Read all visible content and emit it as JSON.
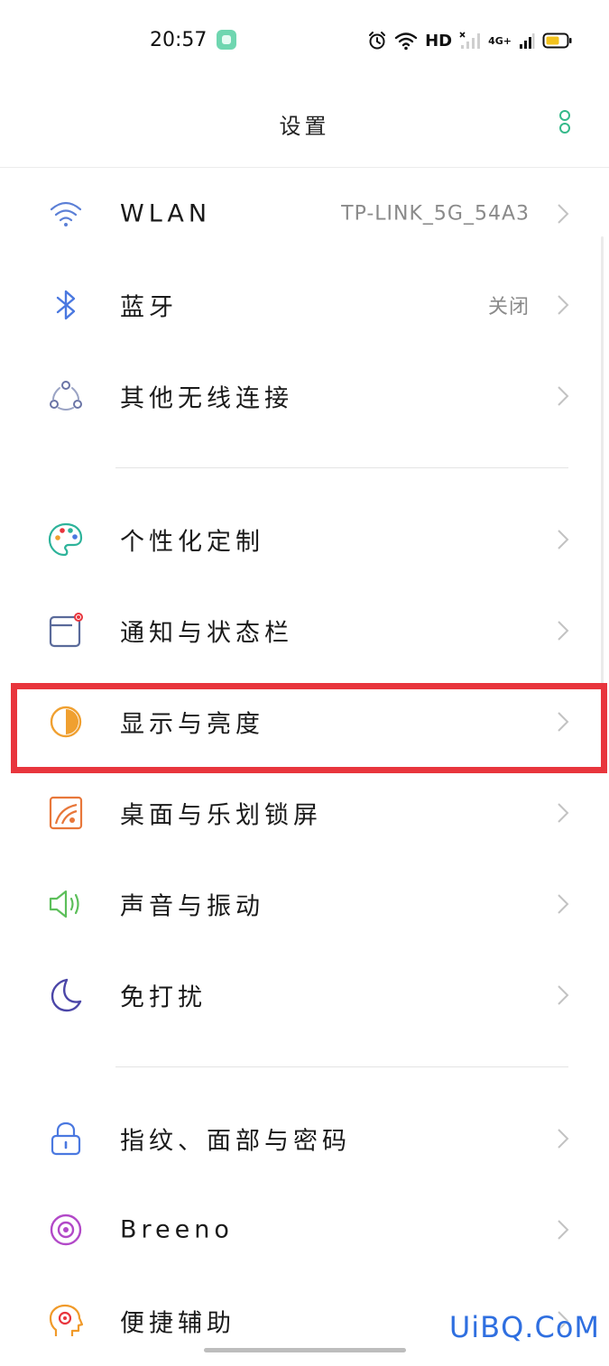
{
  "status_bar": {
    "time": "20:57",
    "hd_label": "HD",
    "net_label": "4G+"
  },
  "header": {
    "title": "设置"
  },
  "groups": [
    {
      "items": [
        {
          "label": "WLAN",
          "value": "TP-LINK_5G_54A3",
          "icon": "wifi-icon",
          "color": "#5b7fd6"
        },
        {
          "label": "蓝牙",
          "value": "关闭",
          "icon": "bluetooth-icon",
          "color": "#4a78e0"
        },
        {
          "label": "其他无线连接",
          "value": "",
          "icon": "connection-icon",
          "color": "#8a94b8"
        }
      ]
    },
    {
      "items": [
        {
          "label": "个性化定制",
          "value": "",
          "icon": "palette-icon",
          "color": "#2db39a"
        },
        {
          "label": "通知与状态栏",
          "value": "",
          "icon": "notification-icon",
          "color": "#5a6a9a"
        },
        {
          "label": "显示与亮度",
          "value": "",
          "icon": "brightness-icon",
          "color": "#f0a030"
        },
        {
          "label": "桌面与乐划锁屏",
          "value": "",
          "icon": "wallpaper-icon",
          "color": "#e8773a"
        },
        {
          "label": "声音与振动",
          "value": "",
          "icon": "speaker-icon",
          "color": "#5cbf5a"
        },
        {
          "label": "免打扰",
          "value": "",
          "icon": "moon-icon",
          "color": "#4b46a8"
        }
      ]
    },
    {
      "items": [
        {
          "label": "指纹、面部与密码",
          "value": "",
          "icon": "lock-icon",
          "color": "#4a78e0"
        },
        {
          "label": "Breeno",
          "value": "",
          "icon": "breeno-icon",
          "color": "#b249c8"
        },
        {
          "label": "便捷辅助",
          "value": "",
          "icon": "assist-icon",
          "color": "#f09a2a"
        }
      ]
    }
  ],
  "highlighted_item": "显示与亮度",
  "watermark": "UiBQ.CoM",
  "accent_color": "#35b98a",
  "highlight_color": "#e8353d"
}
